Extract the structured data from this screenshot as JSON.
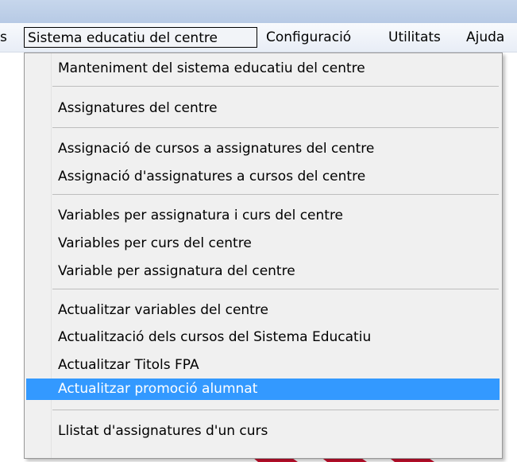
{
  "menubar": {
    "partial_item": "s",
    "active_menu": "Sistema educatiu del centre",
    "config_menu": "Configuració",
    "utils_menu": "Utilitats",
    "help_menu": "Ajuda"
  },
  "dropdown": {
    "items": [
      {
        "label": "Manteniment del sistema educatiu del centre"
      },
      {
        "label": "Assignatures del centre"
      },
      {
        "label": "Assignació de cursos a assignatures del centre"
      },
      {
        "label": "Assignació d'assignatures a cursos del centre"
      },
      {
        "label": "Variables per assignatura i curs del centre"
      },
      {
        "label": "Variables per curs del centre"
      },
      {
        "label": "Variable per assignatura del centre"
      },
      {
        "label": "Actualitzar variables del centre"
      },
      {
        "label": "Actualització dels cursos del Sistema Educatiu"
      },
      {
        "label": "Actualitzar Titols FPA"
      },
      {
        "label": "Actualitzar promoció alumnat",
        "highlighted": true
      },
      {
        "label": "Llistat d'assignatures d'un curs"
      }
    ]
  },
  "colors": {
    "highlight": "#3399ff",
    "menu_background": "#f0f0f0",
    "titlebar": "#bccde7",
    "background_decoration": "#c8102e"
  }
}
